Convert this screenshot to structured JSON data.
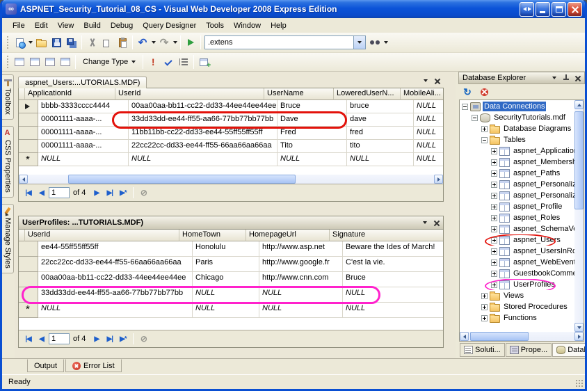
{
  "window": {
    "title": "ASPNET_Security_Tutorial_08_CS - Visual Web Developer 2008 Express Edition",
    "control_icons": [
      "switch-windows-icon",
      "minimize-icon",
      "maximize-icon",
      "close-icon"
    ]
  },
  "menu_bar": {
    "items": [
      "File",
      "Edit",
      "View",
      "Build",
      "Debug",
      "Query Designer",
      "Tools",
      "Window",
      "Help"
    ]
  },
  "toolbar_main": {
    "icon_names": [
      "new-website-icon",
      "open-file-icon",
      "save-icon",
      "save-all-icon",
      "cut-icon",
      "copy-icon",
      "paste-icon",
      "undo-icon",
      "redo-icon",
      "start-debug-icon",
      "find-options-icon"
    ],
    "find_value": ".extens"
  },
  "toolbar_query": {
    "pane_icon_names": [
      "show-diagram-pane-icon",
      "show-criteria-pane-icon",
      "show-sql-pane-icon",
      "show-results-pane-icon"
    ],
    "change_type_label": "Change Type",
    "action_icon_names": [
      "execute-sql-icon",
      "verify-sql-icon",
      "group-by-icon",
      "add-table-icon"
    ]
  },
  "side_tabs": [
    {
      "label": "Toolbox",
      "icon": "toolbox-icon"
    },
    {
      "label": "CSS Properties",
      "icon": "css-properties-icon"
    },
    {
      "label": "Manage Styles",
      "icon": "manage-styles-icon"
    }
  ],
  "users_window": {
    "tab_title": "aspnet_Users:...UTORIALS.MDF)",
    "columns": [
      "ApplicationId",
      "UserId",
      "UserName",
      "LoweredUserN...",
      "MobileAli..."
    ],
    "rows": [
      {
        "selector": "arrow",
        "cells": [
          "bbbb-3333cccc4444",
          "00aa00aa-bb11-cc22-dd33-44ee44ee44ee",
          "Bruce",
          "bruce",
          "NULL"
        ]
      },
      {
        "selector": "",
        "highlight": "red",
        "cells": [
          "00001111-aaaa-...",
          "33dd33dd-ee44-ff55-aa66-77bb77bb77bb",
          "Dave",
          "dave",
          "NULL"
        ]
      },
      {
        "selector": "",
        "cells": [
          "00001111-aaaa-...",
          "11bb11bb-cc22-dd33-ee44-55ff55ff55ff",
          "Fred",
          "fred",
          "NULL"
        ]
      },
      {
        "selector": "",
        "cells": [
          "00001111-aaaa-...",
          "22cc22cc-dd33-ee44-ff55-66aa66aa66aa",
          "Tito",
          "tito",
          "NULL"
        ]
      },
      {
        "selector": "star",
        "cells": [
          "NULL",
          "NULL",
          "NULL",
          "NULL",
          "NULL"
        ]
      }
    ],
    "pager": {
      "value": "1",
      "of_label": "of 4"
    }
  },
  "profiles_window": {
    "title": "UserProfiles: ...TUTORIALS.MDF)",
    "columns": [
      "UserId",
      "HomeTown",
      "HomepageUrl",
      "Signature"
    ],
    "rows": [
      {
        "selector": "",
        "cells": [
          "ee44-55ff55ff55ff",
          "Honolulu",
          "http://www.asp.net",
          "Beware the Ides of March!"
        ]
      },
      {
        "selector": "",
        "cells": [
          "22cc22cc-dd33-ee44-ff55-66aa66aa66aa",
          "Paris",
          "http://www.google.fr",
          "C'est la vie."
        ]
      },
      {
        "selector": "",
        "cells": [
          "00aa00aa-bb11-cc22-dd33-44ee44ee44ee",
          "Chicago",
          "http://www.cnn.com",
          "Bruce"
        ]
      },
      {
        "selector": "",
        "highlight": "magenta",
        "cells": [
          "33dd33dd-ee44-ff55-aa66-77bb77bb77bb",
          "NULL",
          "NULL",
          "NULL"
        ]
      },
      {
        "selector": "star",
        "cells": [
          "NULL",
          "NULL",
          "NULL",
          "NULL"
        ]
      }
    ],
    "pager": {
      "value": "1",
      "of_label": "of 4"
    }
  },
  "pager_icons": {
    "first": "|◀",
    "prev": "◀",
    "next": "▶",
    "last": "▶|",
    "new_row": "▶*",
    "stop": "⊘"
  },
  "database_explorer": {
    "title": "Database Explorer",
    "toolbar_icon_names": [
      "refresh-icon",
      "stop-refresh-icon"
    ],
    "tree": [
      {
        "label": "Data Connections",
        "depth": 0,
        "icon": "connections",
        "expand": "minus",
        "selected": true
      },
      {
        "label": "SecurityTutorials.mdf",
        "depth": 1,
        "icon": "database",
        "expand": "minus"
      },
      {
        "label": "Database Diagrams",
        "depth": 2,
        "icon": "folder",
        "expand": "plus"
      },
      {
        "label": "Tables",
        "depth": 2,
        "icon": "folder",
        "expand": "minus"
      },
      {
        "label": "aspnet_Applications",
        "depth": 3,
        "icon": "table",
        "expand": "plus"
      },
      {
        "label": "aspnet_Membership",
        "depth": 3,
        "icon": "table",
        "expand": "plus"
      },
      {
        "label": "aspnet_Paths",
        "depth": 3,
        "icon": "table",
        "expand": "plus"
      },
      {
        "label": "aspnet_PersonalizationAl",
        "depth": 3,
        "icon": "table",
        "expand": "plus"
      },
      {
        "label": "aspnet_PersonalizationPe",
        "depth": 3,
        "icon": "table",
        "expand": "plus"
      },
      {
        "label": "aspnet_Profile",
        "depth": 3,
        "icon": "table",
        "expand": "plus"
      },
      {
        "label": "aspnet_Roles",
        "depth": 3,
        "icon": "table",
        "expand": "plus"
      },
      {
        "label": "aspnet_SchemaVersions",
        "depth": 3,
        "icon": "table",
        "expand": "plus"
      },
      {
        "label": "aspnet_Users",
        "depth": 3,
        "icon": "table",
        "expand": "plus",
        "highlight": "red"
      },
      {
        "label": "aspnet_UsersInRoles",
        "depth": 3,
        "icon": "table",
        "expand": "plus"
      },
      {
        "label": "aspnet_WebEvent_Even",
        "depth": 3,
        "icon": "table",
        "expand": "plus"
      },
      {
        "label": "GuestbookComments",
        "depth": 3,
        "icon": "table",
        "expand": "plus"
      },
      {
        "label": "UserProfiles",
        "depth": 3,
        "icon": "table",
        "expand": "plus",
        "highlight": "magenta"
      },
      {
        "label": "Views",
        "depth": 2,
        "icon": "folder",
        "expand": "plus"
      },
      {
        "label": "Stored Procedures",
        "depth": 2,
        "icon": "folder",
        "expand": "plus"
      },
      {
        "label": "Functions",
        "depth": 2,
        "icon": "folder",
        "expand": "plus"
      }
    ],
    "bottom_tabs": [
      {
        "label": "Soluti...",
        "icon": "solution-explorer-icon"
      },
      {
        "label": "Prope...",
        "icon": "properties-icon"
      },
      {
        "label": "Datab...",
        "icon": "database-explorer-icon",
        "active": true
      }
    ]
  },
  "bottom_panel_tabs": [
    {
      "label": "Output"
    },
    {
      "label": "Error List",
      "icon": "error-list-icon"
    }
  ],
  "status_bar": {
    "text": "Ready"
  },
  "annotations": {
    "red_color": "#E3120B",
    "magenta_color": "#FF22CC"
  }
}
